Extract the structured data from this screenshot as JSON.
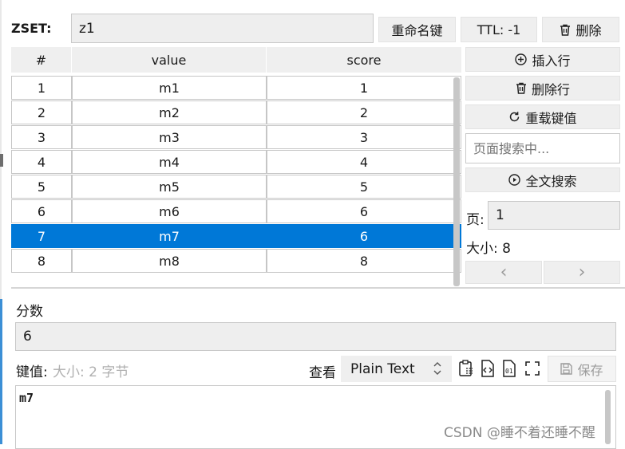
{
  "header": {
    "type_label": "ZSET:",
    "key_name": "z1",
    "rename_label": "重命名键",
    "ttl_label": "TTL:  -1",
    "delete_label": "删除"
  },
  "table": {
    "columns": [
      "#",
      "value",
      "score"
    ],
    "rows": [
      {
        "idx": "1",
        "value": "m1",
        "score": "1"
      },
      {
        "idx": "2",
        "value": "m2",
        "score": "2"
      },
      {
        "idx": "3",
        "value": "m3",
        "score": "3"
      },
      {
        "idx": "4",
        "value": "m4",
        "score": "4"
      },
      {
        "idx": "5",
        "value": "m5",
        "score": "5"
      },
      {
        "idx": "6",
        "value": "m6",
        "score": "6"
      },
      {
        "idx": "7",
        "value": "m7",
        "score": "6"
      },
      {
        "idx": "8",
        "value": "m8",
        "score": "8"
      }
    ],
    "selected_row": 7
  },
  "side": {
    "insert_label": "插入行",
    "delete_row_label": "删除行",
    "reload_label": "重载键值",
    "search_placeholder": "页面搜索中...",
    "fulltext_label": "全文搜索",
    "page_label": "页:",
    "page_value": "1",
    "size_label": "大小:  8",
    "prev": "‹",
    "next": "›"
  },
  "editor": {
    "score_label": "分数",
    "score_value": "6",
    "value_label": "键值:",
    "value_size": "大小:  2 字节",
    "view_label": "查看",
    "format": "Plain Text",
    "save_label": "保存",
    "content": "m7"
  },
  "watermark": "CSDN @睡不着还睡不醒",
  "colors": {
    "selection": "#0078d7",
    "button_bg": "#efefef"
  }
}
